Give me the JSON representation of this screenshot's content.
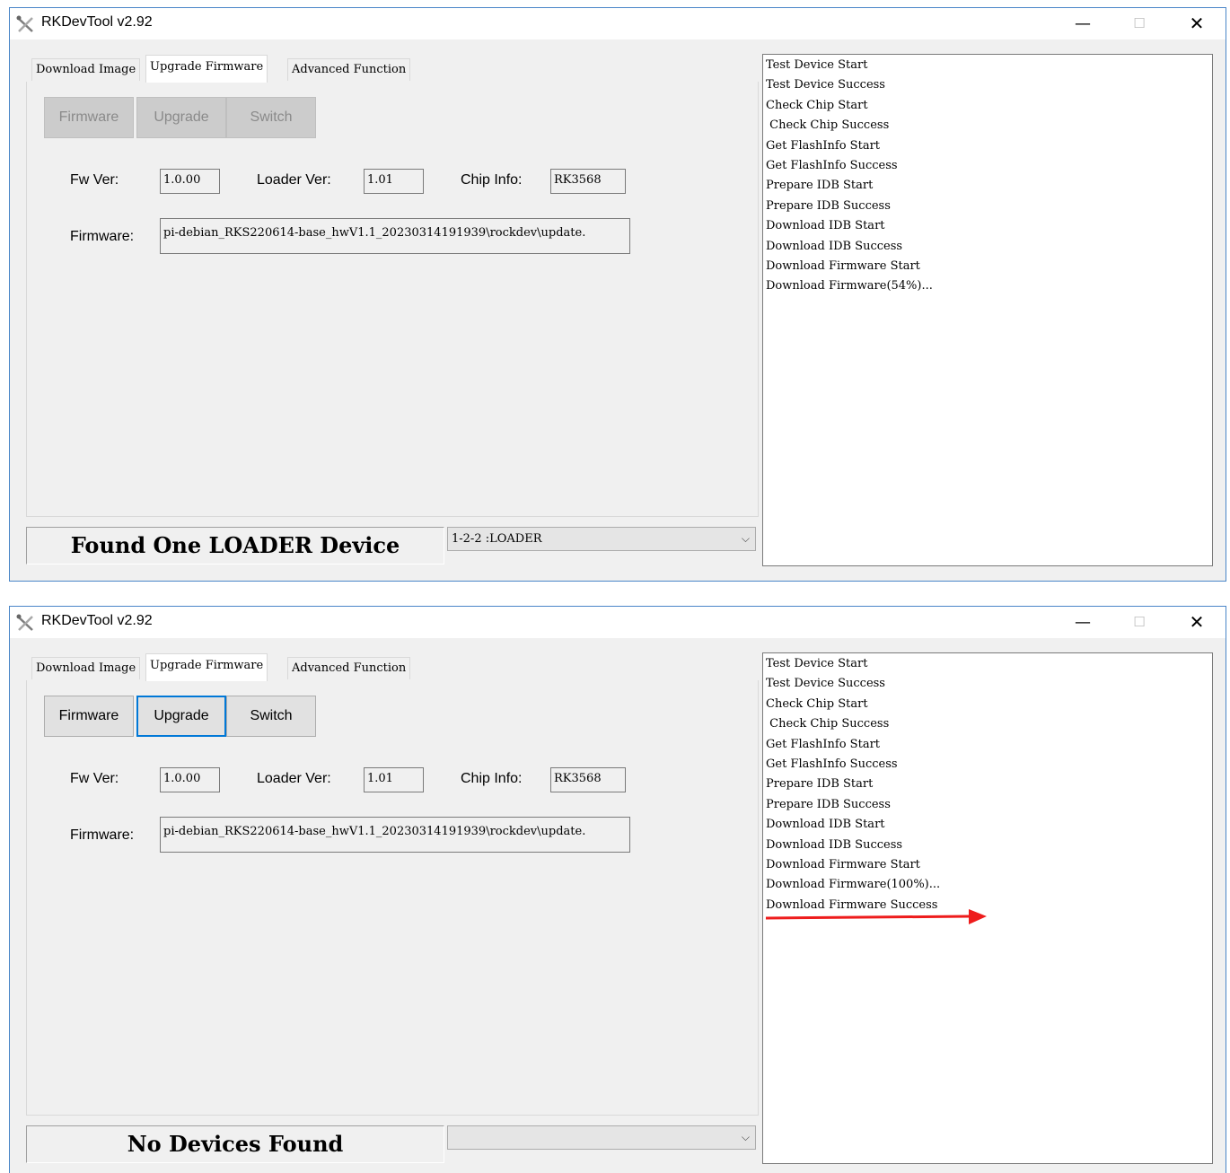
{
  "colors": {
    "titlebar": "#ffffff",
    "window_bg": "#f0f0f0",
    "focus_border": "#0078d7",
    "annotation_arrow": "#ee1c1c"
  },
  "windows": [
    {
      "title": "RKDevTool v2.92",
      "controls": {
        "minimize": "—",
        "maximize": "☐",
        "close": "✕"
      },
      "tabs": [
        "Download Image",
        "Upgrade Firmware",
        "Advanced Function"
      ],
      "active_tab": "Upgrade Firmware",
      "buttons": {
        "firmware": "Firmware",
        "upgrade": "Upgrade",
        "switch": "Switch",
        "state": "disabled"
      },
      "labels": {
        "fw_ver": "Fw Ver:",
        "loader_ver": "Loader Ver:",
        "chip_info": "Chip Info:",
        "firmware": "Firmware:"
      },
      "fields": {
        "fw_ver": "1.0.00",
        "loader_ver": "1.01",
        "chip_info": "RK3568",
        "firmware_path": "pi-debian_RKS220614-base_hwV1.1_20230314191939\\rockdev\\update."
      },
      "status": "Found One LOADER Device",
      "device_combo": "1-2-2 :LOADER",
      "log": [
        "Test Device Start",
        "Test Device Success",
        "Check Chip Start",
        " Check Chip Success",
        "Get FlashInfo Start",
        "Get FlashInfo Success",
        "Prepare IDB Start",
        "Prepare IDB Success",
        "Download IDB Start",
        "Download IDB Success",
        "Download Firmware Start",
        "Download Firmware(54%)..."
      ]
    },
    {
      "title": "RKDevTool v2.92",
      "controls": {
        "minimize": "—",
        "maximize": "☐",
        "close": "✕"
      },
      "tabs": [
        "Download Image",
        "Upgrade Firmware",
        "Advanced Function"
      ],
      "active_tab": "Upgrade Firmware",
      "buttons": {
        "firmware": "Firmware",
        "upgrade": "Upgrade",
        "switch": "Switch",
        "state": "enabled",
        "focused": "Upgrade"
      },
      "labels": {
        "fw_ver": "Fw Ver:",
        "loader_ver": "Loader Ver:",
        "chip_info": "Chip Info:",
        "firmware": "Firmware:"
      },
      "fields": {
        "fw_ver": "1.0.00",
        "loader_ver": "1.01",
        "chip_info": "RK3568",
        "firmware_path": "pi-debian_RKS220614-base_hwV1.1_20230314191939\\rockdev\\update."
      },
      "status": "No Devices Found",
      "device_combo": "",
      "log": [
        "Test Device Start",
        "Test Device Success",
        "Check Chip Start",
        " Check Chip Success",
        "Get FlashInfo Start",
        "Get FlashInfo Success",
        "Prepare IDB Start",
        "Prepare IDB Success",
        "Download IDB Start",
        "Download IDB Success",
        "Download Firmware Start",
        "Download Firmware(100%)...",
        "Download Firmware Success"
      ],
      "annotation": "red-arrow-pointing-at-success"
    }
  ]
}
